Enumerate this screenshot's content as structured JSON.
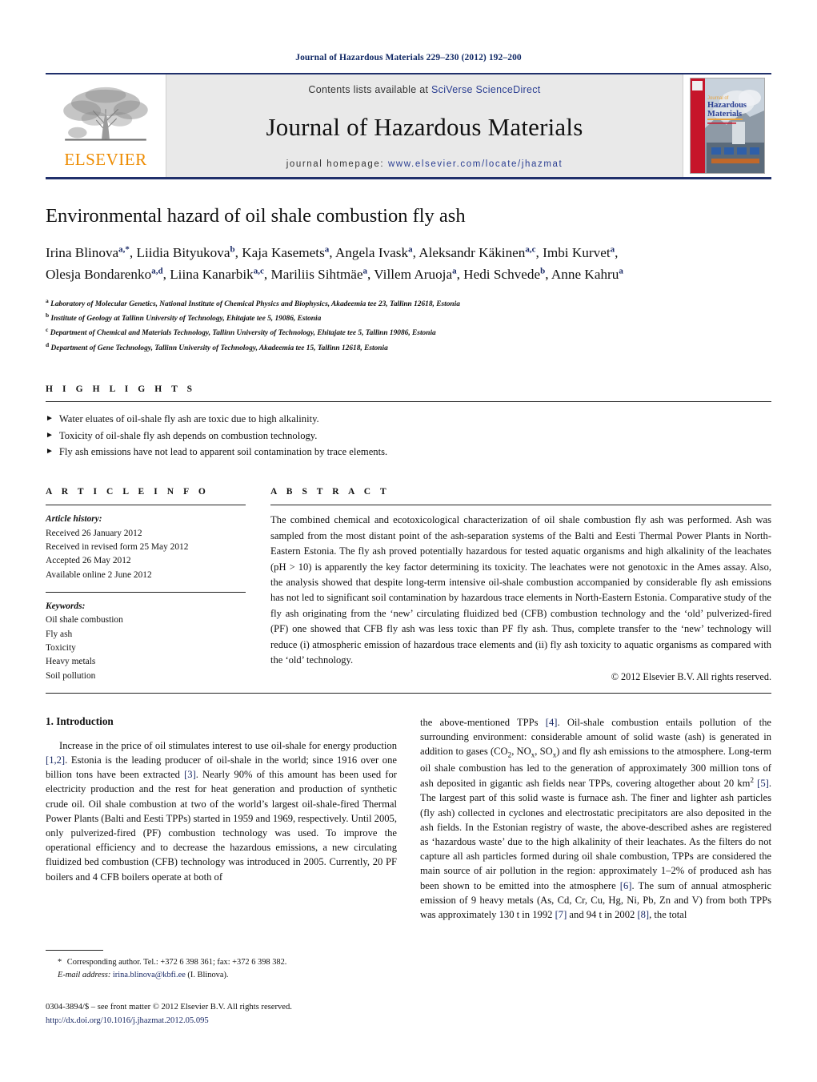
{
  "running_head": "Journal of Hazardous Materials 229–230 (2012) 192–200",
  "masthead": {
    "contents_prefix": "Contents lists available at ",
    "contents_link": "SciVerse ScienceDirect",
    "journal_name": "Journal of Hazardous Materials",
    "homepage_prefix": "journal homepage: ",
    "homepage_url": "www.elsevier.com/locate/jhazmat",
    "publisher_wordmark": "ELSEVIER",
    "cover_title_line1": "Journal of",
    "cover_title_line2": "Hazardous",
    "cover_title_line3": "Materials",
    "link_color": "#2b3f92",
    "rule_color": "#20306b",
    "panel_color": "#e9e9e9",
    "elsevier_orange": "#ED8B00"
  },
  "title": "Environmental hazard of oil shale combustion fly ash",
  "authors_line1": "Irina Blinova<sup>a,*</sup>, Liidia Bityukova<sup>b</sup>, Kaja Kasemets<sup>a</sup>, Angela Ivask<sup>a</sup>, Aleksandr Käkinen<sup>a,c</sup>, Imbi Kurvet<sup>a</sup>,",
  "authors_line2": "Olesja Bondarenko<sup>a,d</sup>, Liina Kanarbik<sup>a,c</sup>, Mariliis Sihtmäe<sup>a</sup>, Villem Aruoja<sup>a</sup>, Hedi Schvede<sup>b</sup>, Anne Kahru<sup>a</sup>",
  "affiliations": [
    "<sup>a</sup> Laboratory of Molecular Genetics, National Institute of Chemical Physics and Biophysics, Akadeemia tee 23, Tallinn 12618, Estonia",
    "<sup>b</sup> Institute of Geology at Tallinn University of Technology, Ehitajate tee 5, 19086, Estonia",
    "<sup>c</sup> Department of Chemical and Materials Technology, Tallinn University of Technology, Ehitajate tee 5, Tallinn 19086, Estonia",
    "<sup>d</sup> Department of Gene Technology, Tallinn University of Technology, Akadeemia tee 15, Tallinn 12618, Estonia"
  ],
  "highlights": {
    "heading": "H I G H L I G H T S",
    "items": [
      "Water eluates of oil-shale fly ash are toxic due to high alkalinity.",
      "Toxicity of oil-shale fly ash depends on combustion technology.",
      "Fly ash emissions have not lead to apparent soil contamination by trace elements."
    ],
    "bullet": "►"
  },
  "article_info": {
    "heading": "A R T I C L E    I N F O",
    "history_label": "Article history:",
    "history": [
      "Received 26 January 2012",
      "Received in revised form 25 May 2012",
      "Accepted 26 May 2012",
      "Available online 2 June 2012"
    ],
    "keywords_label": "Keywords:",
    "keywords": [
      "Oil shale combustion",
      "Fly ash",
      "Toxicity",
      "Heavy metals",
      "Soil pollution"
    ]
  },
  "abstract": {
    "heading": "A B S T R A C T",
    "text": "The combined chemical and ecotoxicological characterization of oil shale combustion fly ash was performed. Ash was sampled from the most distant point of the ash-separation systems of the Balti and Eesti Thermal Power Plants in North-Eastern Estonia. The fly ash proved potentially hazardous for tested aquatic organisms and high alkalinity of the leachates (pH > 10) is apparently the key factor determining its toxicity. The leachates were not genotoxic in the Ames assay. Also, the analysis showed that despite long-term intensive oil-shale combustion accompanied by considerable fly ash emissions has not led to significant soil contamination by hazardous trace elements in North-Eastern Estonia. Comparative study of the fly ash originating from the ‘new’ circulating fluidized bed (CFB) combustion technology and the ‘old’ pulverized-fired (PF) one showed that CFB fly ash was less toxic than PF fly ash. Thus, complete transfer to the ‘new’ technology will reduce (i) atmospheric emission of hazardous trace elements and (ii) fly ash toxicity to aquatic organisms as compared with the ‘old’ technology.",
    "copyright": "© 2012 Elsevier B.V. All rights reserved."
  },
  "body": {
    "section_number_title": "1.  Introduction",
    "left_paragraph_html": "Increase in the price of oil stimulates interest to use oil-shale for energy production <span class=\"ref\">[1,2]</span>. Estonia is the leading producer of oil-shale in the world; since 1916 over one billion tons have been extracted <span class=\"ref\">[3]</span>. Nearly 90% of this amount has been used for electricity production and the rest for heat generation and production of synthetic crude oil. Oil shale combustion at two of the world’s largest oil-shale-fired Thermal Power Plants (Balti and Eesti TPPs) started in 1959 and 1969, respectively. Until 2005, only pulverized-fired (PF) combustion technology was used. To improve the operational efficiency and to decrease the hazardous emissions, a new circulating fluidized bed combustion (CFB) technology was introduced in 2005. Currently, 20 PF boilers and 4 CFB boilers operate at both of",
    "right_paragraph_html": "the above-mentioned TPPs <span class=\"ref\">[4]</span>. Oil-shale combustion entails pollution of the surrounding environment: considerable amount of solid waste (ash) is generated in addition to gases (CO<span class=\"sub\">2</span>, NO<span class=\"sub\">x</span>, SO<span class=\"sub\">x</span>) and fly ash emissions to the atmosphere. Long-term oil shale combustion has led to the generation of approximately 300 million tons of ash deposited in gigantic ash fields near TPPs, covering altogether about 20 km<span class=\"sup\">2</span> <span class=\"ref\">[5]</span>. The largest part of this solid waste is furnace ash. The finer and lighter ash particles (fly ash) collected in cyclones and electrostatic precipitators are also deposited in the ash fields. In the Estonian registry of waste, the above-described ashes are registered as ‘hazardous waste’ due to the high alkalinity of their leachates. As the filters do not capture all ash particles formed during oil shale combustion, TPPs are considered the main source of air pollution in the region: approximately 1–2% of produced ash has been shown to be emitted into the atmosphere <span class=\"ref\">[6]</span>. The sum of annual atmospheric emission of 9 heavy metals (As, Cd, Cr, Cu, Hg, Ni, Pb, Zn and V) from both TPPs was approximately 130 t in 1992 <span class=\"ref\">[7]</span> and 94 t in 2002 <span class=\"ref\">[8]</span>, the total"
  },
  "footnote": {
    "corresponding_html": "<span class=\"star\">*</span> Corresponding author. Tel.: +372 6 398 361; fax: +372 6 398 382.",
    "email_html": "<i>E-mail address:</i> <span class=\"fn-mail\">irina.blinova@kbfi.ee</span> (I. Blinova)."
  },
  "issn": {
    "line1_html": "0304-3894/$ – see front matter © 2012 Elsevier B.V. All rights reserved.",
    "line2_html": "<span class=\"doi\">http://dx.doi.org/10.1016/j.jhazmat.2012.05.095</span>"
  }
}
